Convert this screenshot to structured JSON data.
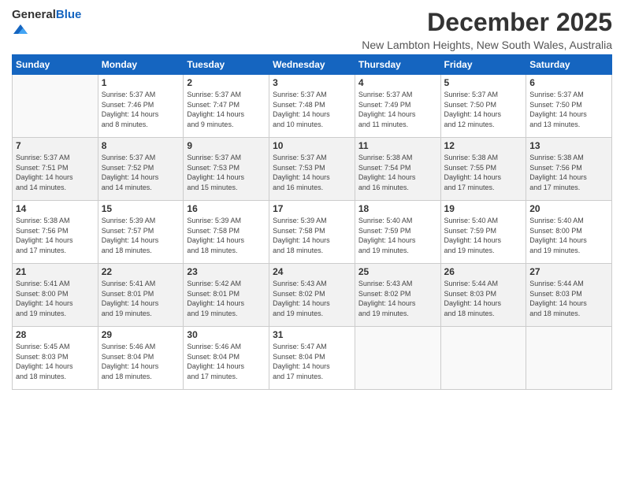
{
  "logo": {
    "general": "General",
    "blue": "Blue"
  },
  "header": {
    "title": "December 2025",
    "subtitle": "New Lambton Heights, New South Wales, Australia"
  },
  "weekdays": [
    "Sunday",
    "Monday",
    "Tuesday",
    "Wednesday",
    "Thursday",
    "Friday",
    "Saturday"
  ],
  "weeks": [
    [
      {
        "day": "",
        "info": ""
      },
      {
        "day": "1",
        "info": "Sunrise: 5:37 AM\nSunset: 7:46 PM\nDaylight: 14 hours\nand 8 minutes."
      },
      {
        "day": "2",
        "info": "Sunrise: 5:37 AM\nSunset: 7:47 PM\nDaylight: 14 hours\nand 9 minutes."
      },
      {
        "day": "3",
        "info": "Sunrise: 5:37 AM\nSunset: 7:48 PM\nDaylight: 14 hours\nand 10 minutes."
      },
      {
        "day": "4",
        "info": "Sunrise: 5:37 AM\nSunset: 7:49 PM\nDaylight: 14 hours\nand 11 minutes."
      },
      {
        "day": "5",
        "info": "Sunrise: 5:37 AM\nSunset: 7:50 PM\nDaylight: 14 hours\nand 12 minutes."
      },
      {
        "day": "6",
        "info": "Sunrise: 5:37 AM\nSunset: 7:50 PM\nDaylight: 14 hours\nand 13 minutes."
      }
    ],
    [
      {
        "day": "7",
        "info": "Sunrise: 5:37 AM\nSunset: 7:51 PM\nDaylight: 14 hours\nand 14 minutes."
      },
      {
        "day": "8",
        "info": "Sunrise: 5:37 AM\nSunset: 7:52 PM\nDaylight: 14 hours\nand 14 minutes."
      },
      {
        "day": "9",
        "info": "Sunrise: 5:37 AM\nSunset: 7:53 PM\nDaylight: 14 hours\nand 15 minutes."
      },
      {
        "day": "10",
        "info": "Sunrise: 5:37 AM\nSunset: 7:53 PM\nDaylight: 14 hours\nand 16 minutes."
      },
      {
        "day": "11",
        "info": "Sunrise: 5:38 AM\nSunset: 7:54 PM\nDaylight: 14 hours\nand 16 minutes."
      },
      {
        "day": "12",
        "info": "Sunrise: 5:38 AM\nSunset: 7:55 PM\nDaylight: 14 hours\nand 17 minutes."
      },
      {
        "day": "13",
        "info": "Sunrise: 5:38 AM\nSunset: 7:56 PM\nDaylight: 14 hours\nand 17 minutes."
      }
    ],
    [
      {
        "day": "14",
        "info": "Sunrise: 5:38 AM\nSunset: 7:56 PM\nDaylight: 14 hours\nand 17 minutes."
      },
      {
        "day": "15",
        "info": "Sunrise: 5:39 AM\nSunset: 7:57 PM\nDaylight: 14 hours\nand 18 minutes."
      },
      {
        "day": "16",
        "info": "Sunrise: 5:39 AM\nSunset: 7:58 PM\nDaylight: 14 hours\nand 18 minutes."
      },
      {
        "day": "17",
        "info": "Sunrise: 5:39 AM\nSunset: 7:58 PM\nDaylight: 14 hours\nand 18 minutes."
      },
      {
        "day": "18",
        "info": "Sunrise: 5:40 AM\nSunset: 7:59 PM\nDaylight: 14 hours\nand 19 minutes."
      },
      {
        "day": "19",
        "info": "Sunrise: 5:40 AM\nSunset: 7:59 PM\nDaylight: 14 hours\nand 19 minutes."
      },
      {
        "day": "20",
        "info": "Sunrise: 5:40 AM\nSunset: 8:00 PM\nDaylight: 14 hours\nand 19 minutes."
      }
    ],
    [
      {
        "day": "21",
        "info": "Sunrise: 5:41 AM\nSunset: 8:00 PM\nDaylight: 14 hours\nand 19 minutes."
      },
      {
        "day": "22",
        "info": "Sunrise: 5:41 AM\nSunset: 8:01 PM\nDaylight: 14 hours\nand 19 minutes."
      },
      {
        "day": "23",
        "info": "Sunrise: 5:42 AM\nSunset: 8:01 PM\nDaylight: 14 hours\nand 19 minutes."
      },
      {
        "day": "24",
        "info": "Sunrise: 5:43 AM\nSunset: 8:02 PM\nDaylight: 14 hours\nand 19 minutes."
      },
      {
        "day": "25",
        "info": "Sunrise: 5:43 AM\nSunset: 8:02 PM\nDaylight: 14 hours\nand 19 minutes."
      },
      {
        "day": "26",
        "info": "Sunrise: 5:44 AM\nSunset: 8:03 PM\nDaylight: 14 hours\nand 18 minutes."
      },
      {
        "day": "27",
        "info": "Sunrise: 5:44 AM\nSunset: 8:03 PM\nDaylight: 14 hours\nand 18 minutes."
      }
    ],
    [
      {
        "day": "28",
        "info": "Sunrise: 5:45 AM\nSunset: 8:03 PM\nDaylight: 14 hours\nand 18 minutes."
      },
      {
        "day": "29",
        "info": "Sunrise: 5:46 AM\nSunset: 8:04 PM\nDaylight: 14 hours\nand 18 minutes."
      },
      {
        "day": "30",
        "info": "Sunrise: 5:46 AM\nSunset: 8:04 PM\nDaylight: 14 hours\nand 17 minutes."
      },
      {
        "day": "31",
        "info": "Sunrise: 5:47 AM\nSunset: 8:04 PM\nDaylight: 14 hours\nand 17 minutes."
      },
      {
        "day": "",
        "info": ""
      },
      {
        "day": "",
        "info": ""
      },
      {
        "day": "",
        "info": ""
      }
    ]
  ]
}
